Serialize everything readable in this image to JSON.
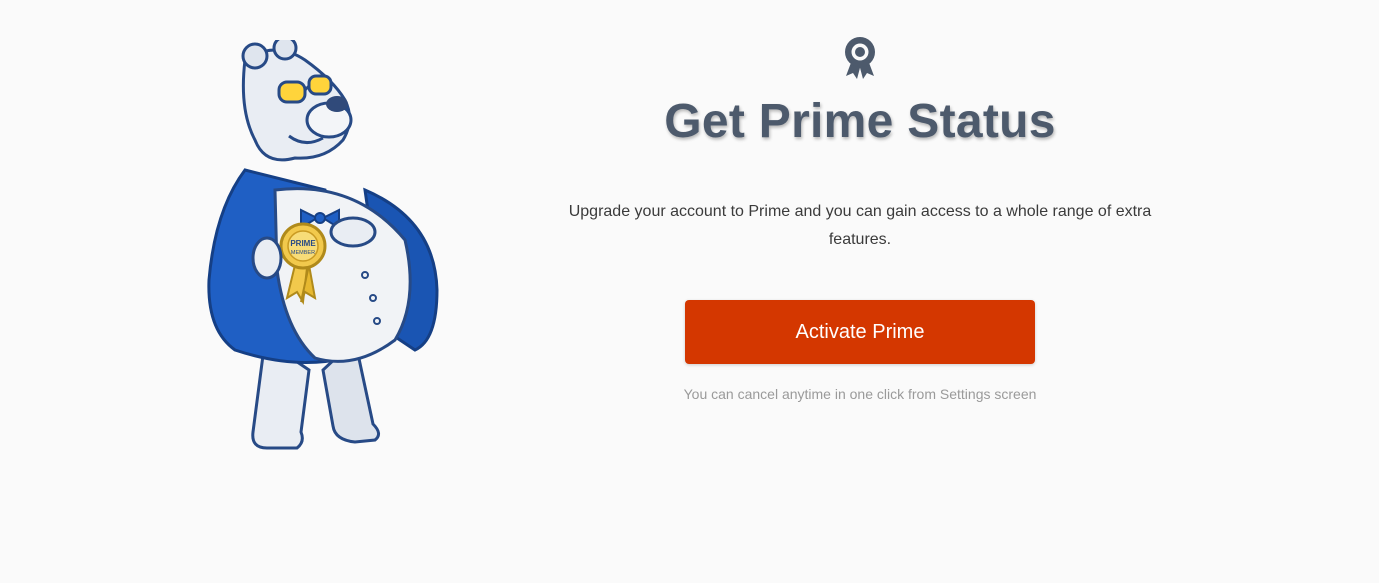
{
  "icons": {
    "header": "ribbon-award-icon",
    "mascot": "polar-bear-mascot"
  },
  "mascot": {
    "medal_text": "PRIME MEMBER"
  },
  "header": {
    "title": "Get Prime Status"
  },
  "main": {
    "description": "Upgrade your account to Prime and you can gain access to a whole range of extra features.",
    "activate_label": "Activate Prime",
    "cancel_note": "You can cancel anytime in one click from Settings screen"
  },
  "colors": {
    "title": "#4d5a6c",
    "button": "#d43700",
    "background": "#fafafa",
    "mascot_jacket": "#1f5fc4",
    "medal": "#f2c94c"
  }
}
